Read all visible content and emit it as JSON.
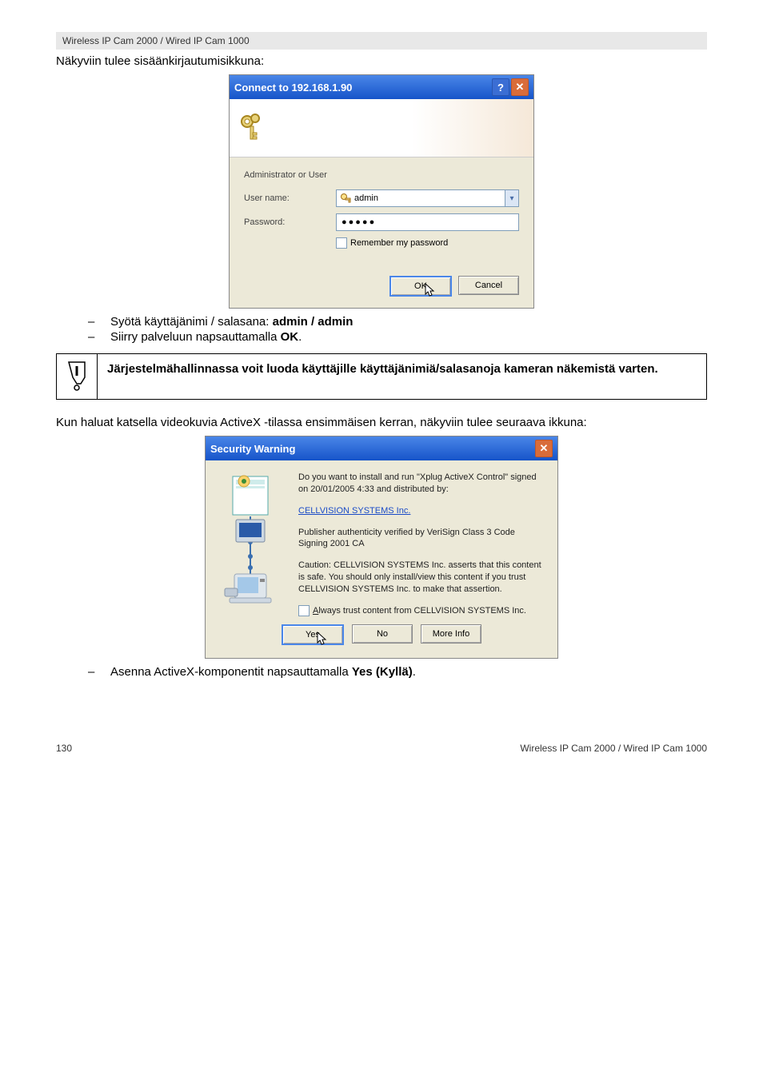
{
  "header_bar": "Wireless IP Cam 2000 / Wired IP Cam 1000",
  "intro": "Näkyviin tulee sisäänkirjautumisikkuna:",
  "login_dialog": {
    "title": "Connect to 192.168.1.90",
    "subtitle": "Administrator or User",
    "user_label": "User name:",
    "user_value": "admin",
    "pwd_label": "Password:",
    "pwd_dots": "●●●●●",
    "remember": "Remember my password",
    "ok": "OK",
    "cancel": "Cancel"
  },
  "bullets1": {
    "a_pre": "Syötä käyttäjänimi / salasana: ",
    "a_bold": "admin / admin",
    "b_pre": "Siirry palveluun napsauttamalla ",
    "b_bold": "OK",
    "b_post": "."
  },
  "callout": "Järjestelmähallinnassa voit luoda käyttäjille käyttäjänimiä/salasanoja kameran näkemistä varten.",
  "para2": "Kun haluat katsella videokuvia ActiveX -tilassa ensimmäisen kerran, näkyviin tulee seuraava ikkuna:",
  "sec_dialog": {
    "title": "Security Warning",
    "q": "Do you want to install and run \"Xplug ActiveX Control\" signed on 20/01/2005 4:33 and distributed by:",
    "link": "CELLVISION SYSTEMS Inc.",
    "verified": "Publisher authenticity verified by VeriSign Class 3 Code Signing 2001 CA",
    "caution": "Caution: CELLVISION SYSTEMS Inc. asserts that this content is safe. You should only install/view this content if you trust CELLVISION SYSTEMS Inc. to make that assertion.",
    "always_pre": "A",
    "always": "lways trust content from CELLVISION SYSTEMS Inc.",
    "yes": "Yes",
    "no": "No",
    "more": "More Info"
  },
  "bullets2": {
    "a_pre": "Asenna ActiveX-komponentit napsauttamalla ",
    "a_bold": "Yes (Kyllä)",
    "a_post": "."
  },
  "footer_left": "130",
  "footer_right": "Wireless IP Cam 2000 / Wired IP Cam 1000"
}
